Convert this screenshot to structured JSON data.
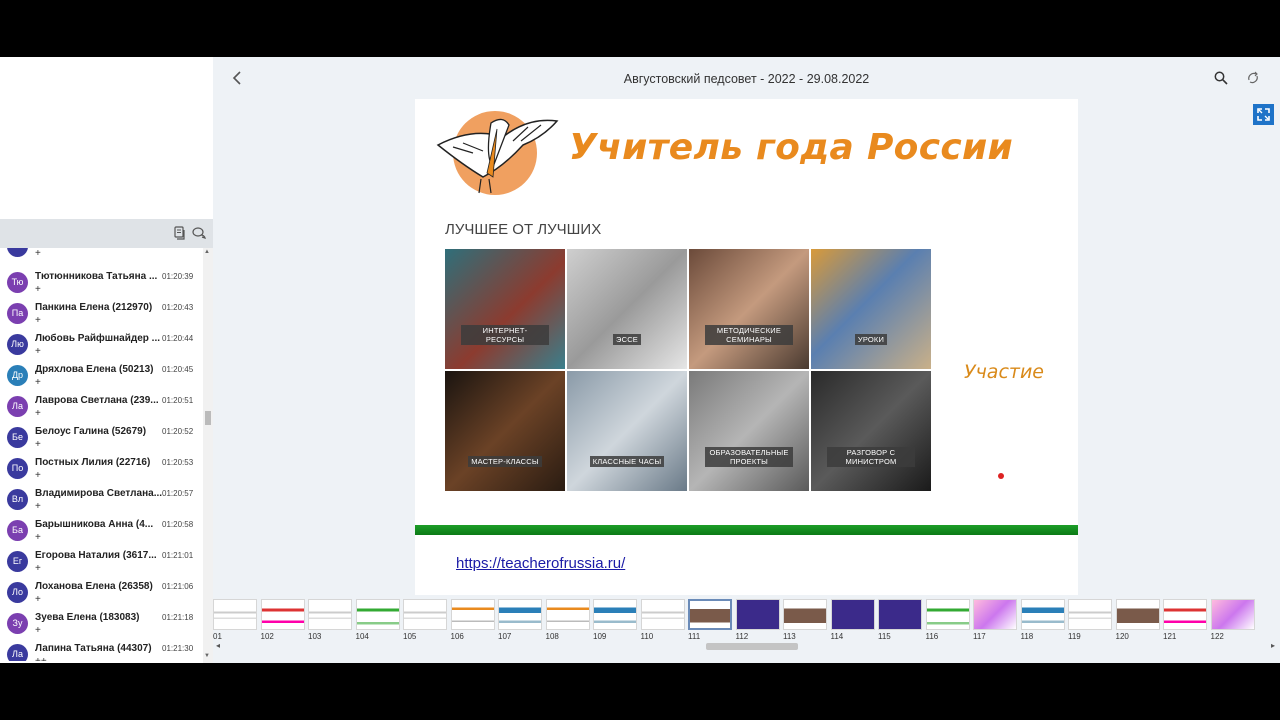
{
  "header": {
    "title": "Августовский педсовет - 2022 - 29.08.2022",
    "back_icon": "chevron-left-icon",
    "search_icon": "search-icon",
    "sync_icon": "sync-icon",
    "fullscreen_icon": "fullscreen-icon"
  },
  "chat": {
    "toolbar_icons": [
      "copy-icon",
      "chat-bubbles-icon"
    ],
    "messages": [
      {
        "initials": "Тю",
        "name": "Тютюнникова Татьяна ...",
        "time": "01:20:39",
        "text": "+",
        "color": "#7b3fb0"
      },
      {
        "initials": "Па",
        "name": "Панкина Елена (212970)",
        "time": "01:20:43",
        "text": "+",
        "color": "#7b3fb0"
      },
      {
        "initials": "Лю",
        "name": "Любовь Райфшнайдер ...",
        "time": "01:20:44",
        "text": "+",
        "color": "#3a3a9e"
      },
      {
        "initials": "Др",
        "name": "Дряхлова Елена (50213)",
        "time": "01:20:45",
        "text": "+",
        "color": "#2a7fb8"
      },
      {
        "initials": "Ла",
        "name": "Лаврова Светлана (239...",
        "time": "01:20:51",
        "text": "+",
        "color": "#7b3fb0"
      },
      {
        "initials": "Бе",
        "name": "Белоус Галина (52679)",
        "time": "01:20:52",
        "text": "+",
        "color": "#3a3a9e"
      },
      {
        "initials": "По",
        "name": "Постных Лилия (22716)",
        "time": "01:20:53",
        "text": "+",
        "color": "#3a3a9e"
      },
      {
        "initials": "Вл",
        "name": "Владимирова Светлана...",
        "time": "01:20:57",
        "text": "+",
        "color": "#3a3a9e"
      },
      {
        "initials": "Ба",
        "name": "Барышникова Анна (4...",
        "time": "01:20:58",
        "text": "+",
        "color": "#7b3fb0"
      },
      {
        "initials": "Ег",
        "name": "Егорова Наталия (3617...",
        "time": "01:21:01",
        "text": "+",
        "color": "#3a3a9e"
      },
      {
        "initials": "Ло",
        "name": "Лоханова Елена (26358)",
        "time": "01:21:06",
        "text": "+",
        "color": "#3a3a9e"
      },
      {
        "initials": "Зу",
        "name": "Зуева Елена (183083)",
        "time": "01:21:18",
        "text": "+",
        "color": "#7b3fb0"
      },
      {
        "initials": "Ла",
        "name": "Лапина Татьяна (44307)",
        "time": "01:21:30",
        "text": "++",
        "color": "#3a3a9e"
      }
    ]
  },
  "slide": {
    "heading": "Учитель года России",
    "subheading": "ЛУЧШЕЕ ОТ ЛУЧШИХ",
    "tiles": [
      {
        "label": "ИНТЕРНЕТ-РЕСУРСЫ",
        "bg": "linear-gradient(135deg,#2f6f7a,#8c3b2f 55%,#3a7f8c)"
      },
      {
        "label": "ЭССЕ",
        "bg": "linear-gradient(135deg,#cfcfcf,#9a9a9a 50%,#e6e6e6)"
      },
      {
        "label": "МЕТОДИЧЕСКИЕ СЕМИНАРЫ",
        "bg": "linear-gradient(135deg,#6b4a3a,#c49a7e 50%,#4a3a30)"
      },
      {
        "label": "УРОКИ",
        "bg": "linear-gradient(135deg,#d89a3a,#5a7fb0 45%,#c9b089)"
      },
      {
        "label": "МАСТЕР-КЛАССЫ",
        "bg": "linear-gradient(135deg,#1a1410,#6b4226 50%,#2a1c12)"
      },
      {
        "label": "КЛАССНЫЕ ЧАСЫ",
        "bg": "linear-gradient(135deg,#8a9aa8,#cfd6dc 50%,#6a7a88)"
      },
      {
        "label": "ОБРАЗОВАТЕЛЬНЫЕ ПРОЕКТЫ",
        "bg": "linear-gradient(135deg,#7a7a7a,#b5b5b5 50%,#5a5a5a)"
      },
      {
        "label": "РАЗГОВОР С МИНИСТРОМ",
        "bg": "linear-gradient(135deg,#2a2a2a,#5a5a5a 50%,#1a1a1a)"
      }
    ],
    "participation": "Участие",
    "link": "https://teacherofrussia.ru/"
  },
  "thumbnails": [
    {
      "num": "01",
      "style": "text"
    },
    {
      "num": "102",
      "style": "red"
    },
    {
      "num": "103",
      "style": "text"
    },
    {
      "num": "104",
      "style": "green"
    },
    {
      "num": "105",
      "style": "text"
    },
    {
      "num": "106",
      "style": "orange"
    },
    {
      "num": "107",
      "style": "blue"
    },
    {
      "num": "108",
      "style": "orange"
    },
    {
      "num": "109",
      "style": "blue"
    },
    {
      "num": "110",
      "style": "text"
    },
    {
      "num": "111",
      "style": "photo",
      "active": true
    },
    {
      "num": "112",
      "style": "purple"
    },
    {
      "num": "113",
      "style": "photo"
    },
    {
      "num": "114",
      "style": "purple"
    },
    {
      "num": "115",
      "style": "purple"
    },
    {
      "num": "116",
      "style": "green"
    },
    {
      "num": "117",
      "style": "pink"
    },
    {
      "num": "118",
      "style": "blue"
    },
    {
      "num": "119",
      "style": "text"
    },
    {
      "num": "120",
      "style": "photo"
    },
    {
      "num": "121",
      "style": "red"
    },
    {
      "num": "122",
      "style": "pink"
    }
  ]
}
